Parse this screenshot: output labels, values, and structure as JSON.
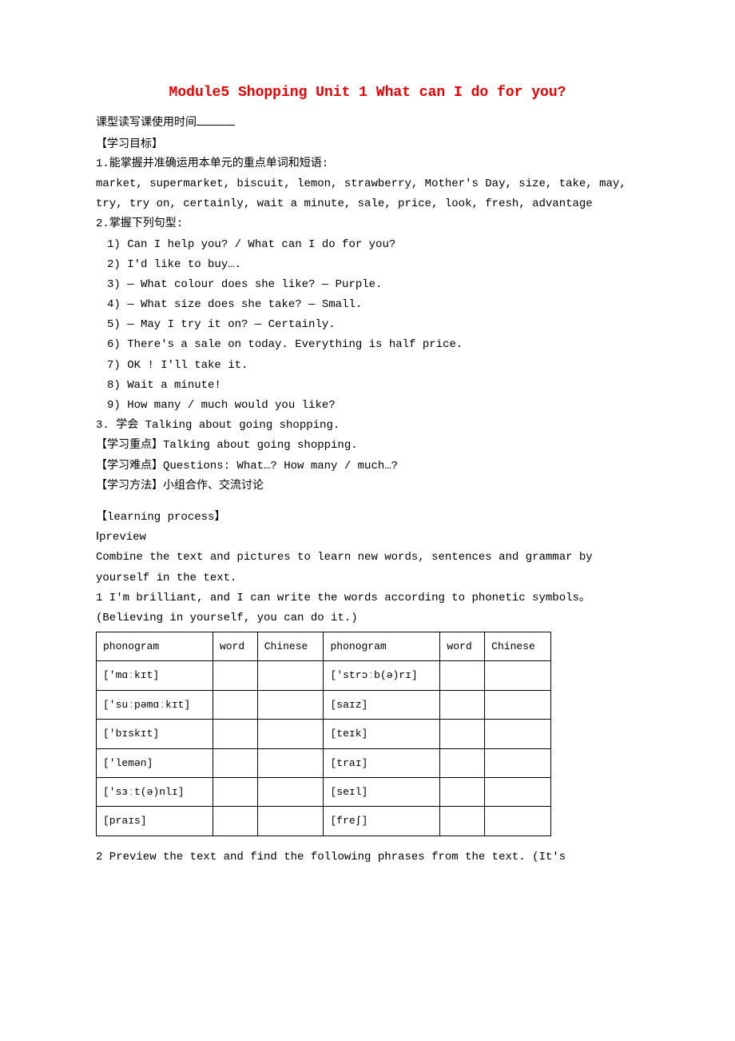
{
  "title": "Module5 Shopping  Unit 1 What can I do for you?",
  "subtitle": "课型读写课使用时间",
  "section1_title": "【学习目标】",
  "goal1": "1.能掌握并准确运用本单元的重点单词和短语:",
  "vocab": "market, supermarket, biscuit, lemon, strawberry, Mother's Day, size, take, may, try, try on, certainly, wait a minute, sale, price, look, fresh, advantage",
  "goal2": "2.掌握下列句型:",
  "patterns": [
    "1) Can I help you? / What can I do for you?",
    "2) I'd like to buy….",
    "3) — What colour does she like?   — Purple.",
    "4) — What size does she take?    — Small.",
    "5) — May I try it on?   — Certainly.",
    "6) There's a sale on today. Everything is half price.",
    "7) OK ! I'll take it.",
    "8) Wait a minute!",
    "9) How many / much would you like?"
  ],
  "goal3": "3. 学会 Talking about going shopping.",
  "focus_label": "【学习重点】",
  "focus_text": "Talking about going shopping.",
  "difficulty_label": "【学习难点】",
  "difficulty_text": "Questions: What…? How many / much…?",
  "method_label": "【学习方法】",
  "method_text": "小组合作、交流讨论",
  "process_label": "【learning process】",
  "preview_label": "Ⅰpreview",
  "preview_text": "Combine the text and pictures to learn new words, sentences and grammar by yourself in the text.",
  "ex1_text": "1 I'm brilliant, and I can write the words according to phonetic symbols。(Believing in yourself, you can do it.)",
  "table": {
    "headers": {
      "phonogram": "phonogram",
      "word": "word",
      "chinese": "Chinese"
    },
    "rows": [
      {
        "left": "['mɑːkɪt]",
        "right": "['strɔːb(ə)rɪ]"
      },
      {
        "left": "['suːpəmɑːkɪt]",
        "right": "[saɪz]"
      },
      {
        "left": "['bɪskɪt]",
        "right": "[teɪk]"
      },
      {
        "left": "['lemən]",
        "right": "[traɪ]"
      },
      {
        "left": "['sɜːt(ə)nlɪ]",
        "right": "[seɪl]"
      },
      {
        "left": "[praɪs]",
        "right": "[freʃ]"
      }
    ]
  },
  "ex2_text": "2 Preview the text and find the following phrases from the text. (It's"
}
